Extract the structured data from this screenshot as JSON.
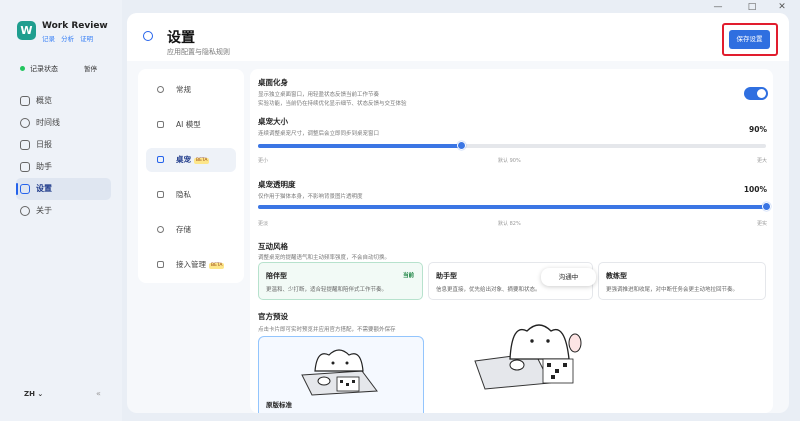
{
  "window": {
    "minimize": "—",
    "maximize": "□",
    "close": "✕"
  },
  "sidebar": {
    "logo_letter": "W",
    "app_title": "Work Review",
    "links": [
      "记录",
      "分析",
      "证明"
    ],
    "status_label": "记录状态",
    "pause_label": "暂停",
    "items": [
      {
        "label": "概览",
        "icon": "overview-icon"
      },
      {
        "label": "时间线",
        "icon": "timeline-icon"
      },
      {
        "label": "日报",
        "icon": "report-icon"
      },
      {
        "label": "助手",
        "icon": "assistant-icon"
      },
      {
        "label": "设置",
        "icon": "settings-icon",
        "active": true
      },
      {
        "label": "关于",
        "icon": "info-icon"
      }
    ],
    "lang": "ZH ⌄",
    "collapse_icon": "«"
  },
  "header": {
    "title": "设置",
    "subtitle": "应用配置与隐私规则",
    "save_label": "保存设置"
  },
  "subnav": {
    "beta": "BETA",
    "items": [
      {
        "label": "常规",
        "icon": "general-icon"
      },
      {
        "label": "AI 模型",
        "icon": "ai-model-icon"
      },
      {
        "label": "桌宠",
        "icon": "pet-icon",
        "active": true,
        "beta": true
      },
      {
        "label": "隐私",
        "icon": "privacy-icon"
      },
      {
        "label": "存储",
        "icon": "storage-icon"
      },
      {
        "label": "接入管理",
        "icon": "integration-icon",
        "beta": true
      }
    ]
  },
  "pet": {
    "enable_title": "桌面化身",
    "enable_desc1": "显示独立桌面窗口，用轻盈状态反馈当前工作节奏",
    "enable_desc2": "实验功能，当前仍在持续优化显示细节、状态反馈与交互体验",
    "enabled": true,
    "size_title": "桌宠大小",
    "size_desc": "连续调整桌宠尺寸，调整后会立即同步到桌宠窗口",
    "size_value": 90,
    "size_pct": "90%",
    "size_ticks": [
      "更小",
      "默认 90%",
      "更大"
    ],
    "opacity_title": "桌宠透明度",
    "opacity_desc": "仅作用于猫体本身，不影响背景图片透明度",
    "opacity_value": 100,
    "opacity_pct": "100%",
    "opacity_ticks": [
      "更淡",
      "默认 82%",
      "更实"
    ],
    "style_title": "互动风格",
    "style_desc": "调整桌宠的提醒语气和主动频率强度，不会自动切换。",
    "styles": [
      {
        "title": "陪伴型",
        "tag": "当前",
        "desc": "更温和、少打断，适合轻提醒和陪伴式工作节奏。",
        "active": true
      },
      {
        "title": "助手型",
        "desc": "信息更直接，优先给出对象、摘要和状态。"
      },
      {
        "title": "教练型",
        "desc": "更强调推进和收尾，对中断任务会更主动地拉回节奏。"
      }
    ],
    "tooltip": "沟通中",
    "preset_title": "官方预设",
    "preset_desc": "点击卡片即可实时预览并应用官方搭配，不需要额外保存",
    "preset_label": "原版标准"
  }
}
